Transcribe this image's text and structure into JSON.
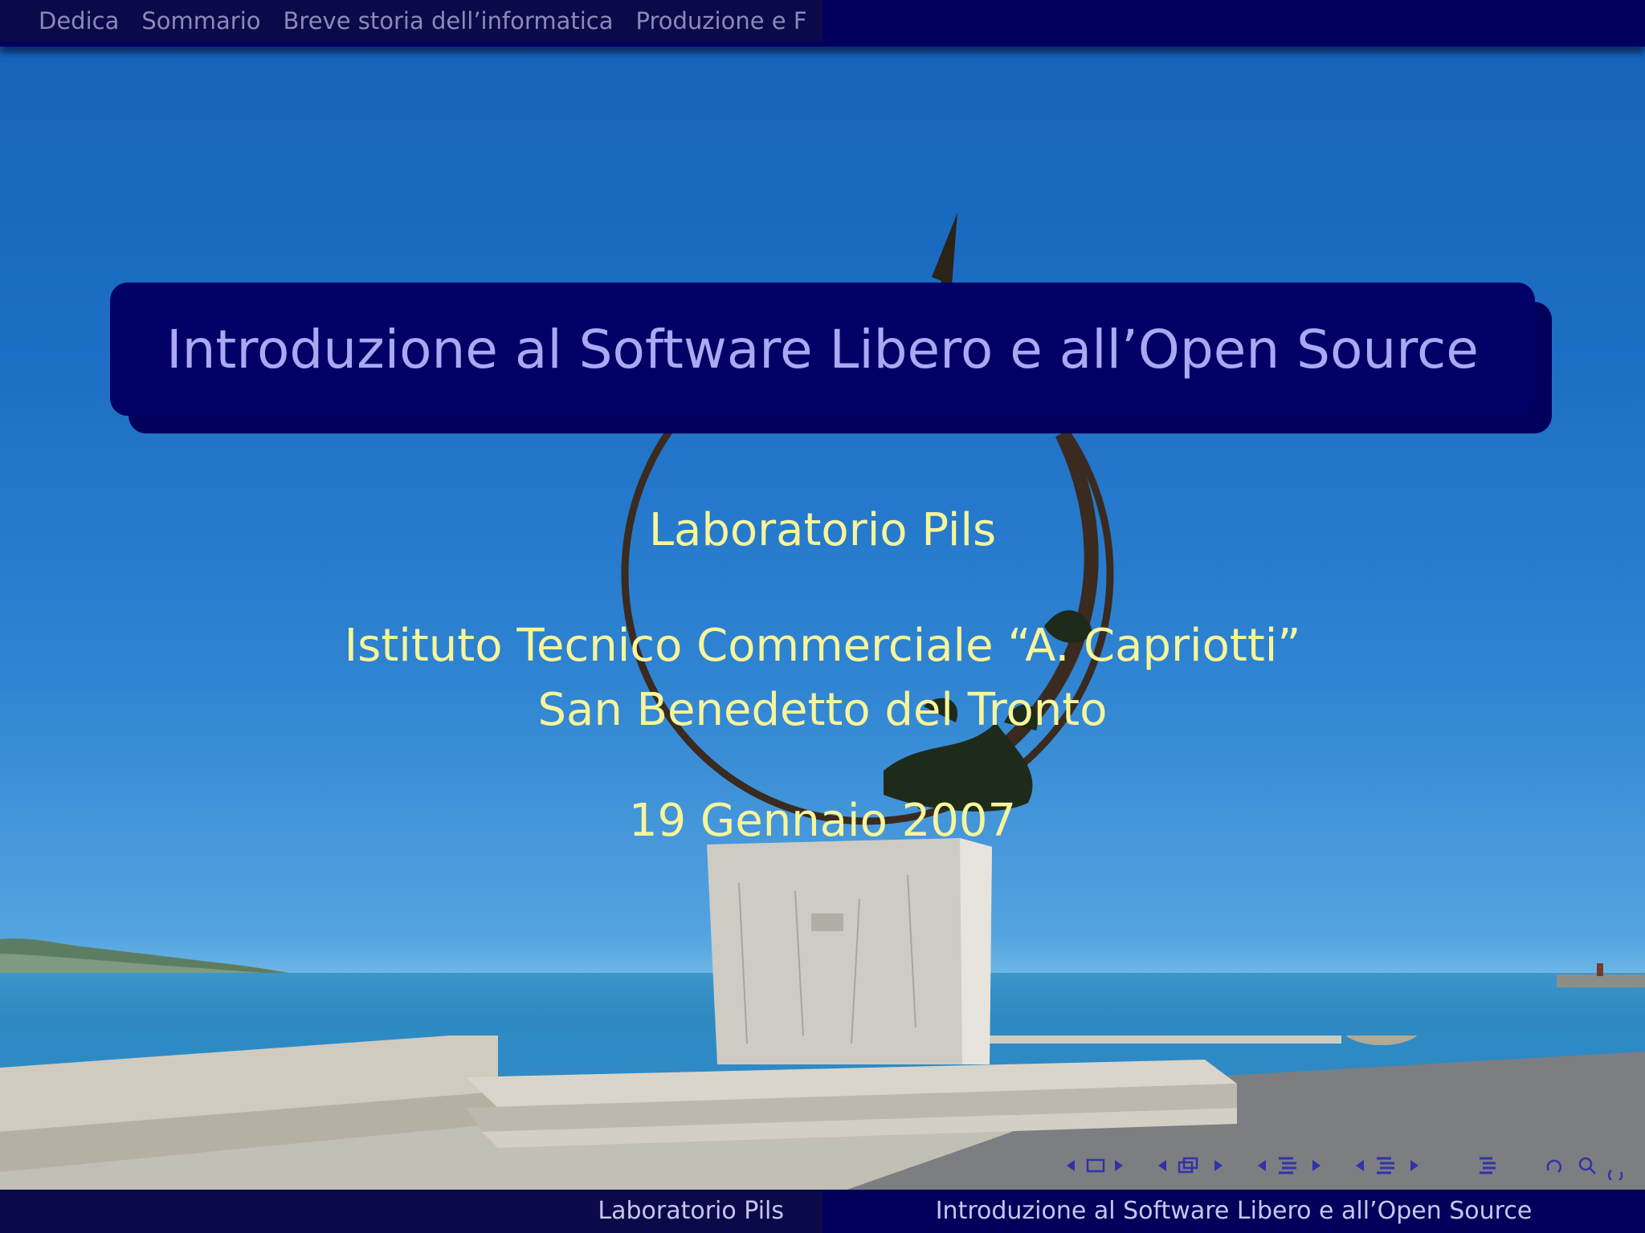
{
  "nav": {
    "sections": [
      "Dedica",
      "Sommario",
      "Breve storia dell’informatica",
      "Produzione e F"
    ]
  },
  "title": "Introduzione al Software Libero e all’Open Source",
  "author": "Laboratorio Pils",
  "institute": {
    "line1": "Istituto Tecnico Commerciale “A. Capriotti”",
    "line2": "San Benedetto del Tronto"
  },
  "date": "19 Gennaio 2007",
  "footer": {
    "left": "Laboratorio Pils",
    "right": "Introduzione al Software Libero e all’Open Source"
  },
  "nav_symbols": [
    "slide-nav",
    "frame-nav",
    "subsection-nav",
    "section-nav",
    "document-nav",
    "back-forward-search"
  ],
  "colors": {
    "bar_dark": "#010062",
    "title_text": "#a9a9f3",
    "body_text": "#f7f59a",
    "footer_text": "#c6c6ee"
  }
}
